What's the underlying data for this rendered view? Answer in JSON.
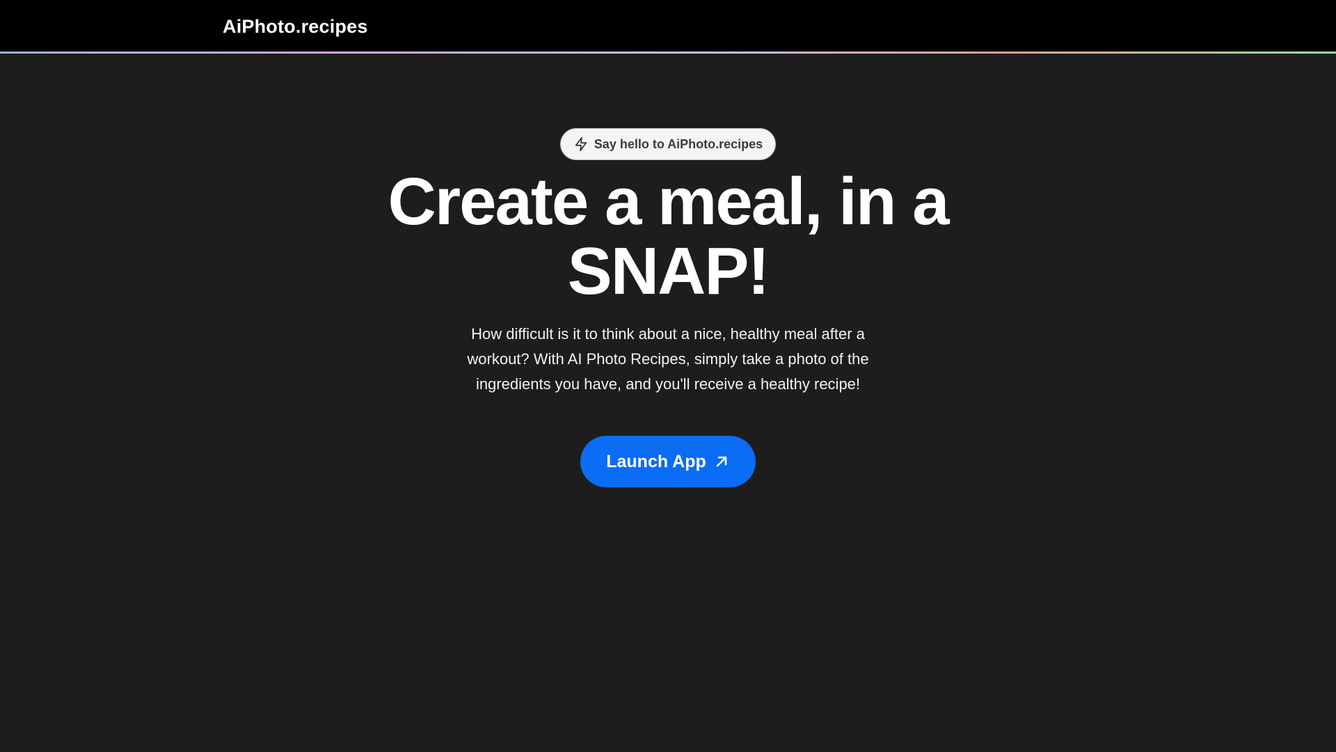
{
  "navbar": {
    "brand": "AiPhoto.recipes"
  },
  "hero": {
    "badge": {
      "icon": "lightning-bolt-icon",
      "label": "Say hello to AiPhoto.recipes"
    },
    "headline_line1": "Create a meal, in a",
    "headline_line2": "SNAP!",
    "description": "How difficult is it to think about a nice, healthy meal after a workout? With AI Photo Recipes, simply take a photo of the ingredients you have, and you'll receive a healthy recipe!",
    "cta": {
      "label": "Launch App",
      "icon": "arrow-up-right-icon"
    }
  },
  "colors": {
    "navbar_bg": "#000000",
    "page_bg": "#1d1d1d",
    "cta_bg": "#0b6cf5",
    "text": "#ffffff",
    "accent_gradient": [
      "#9fb3ff",
      "#d3a6f0",
      "#b9c2ff",
      "#f0a08c",
      "#8fe3a8"
    ]
  }
}
